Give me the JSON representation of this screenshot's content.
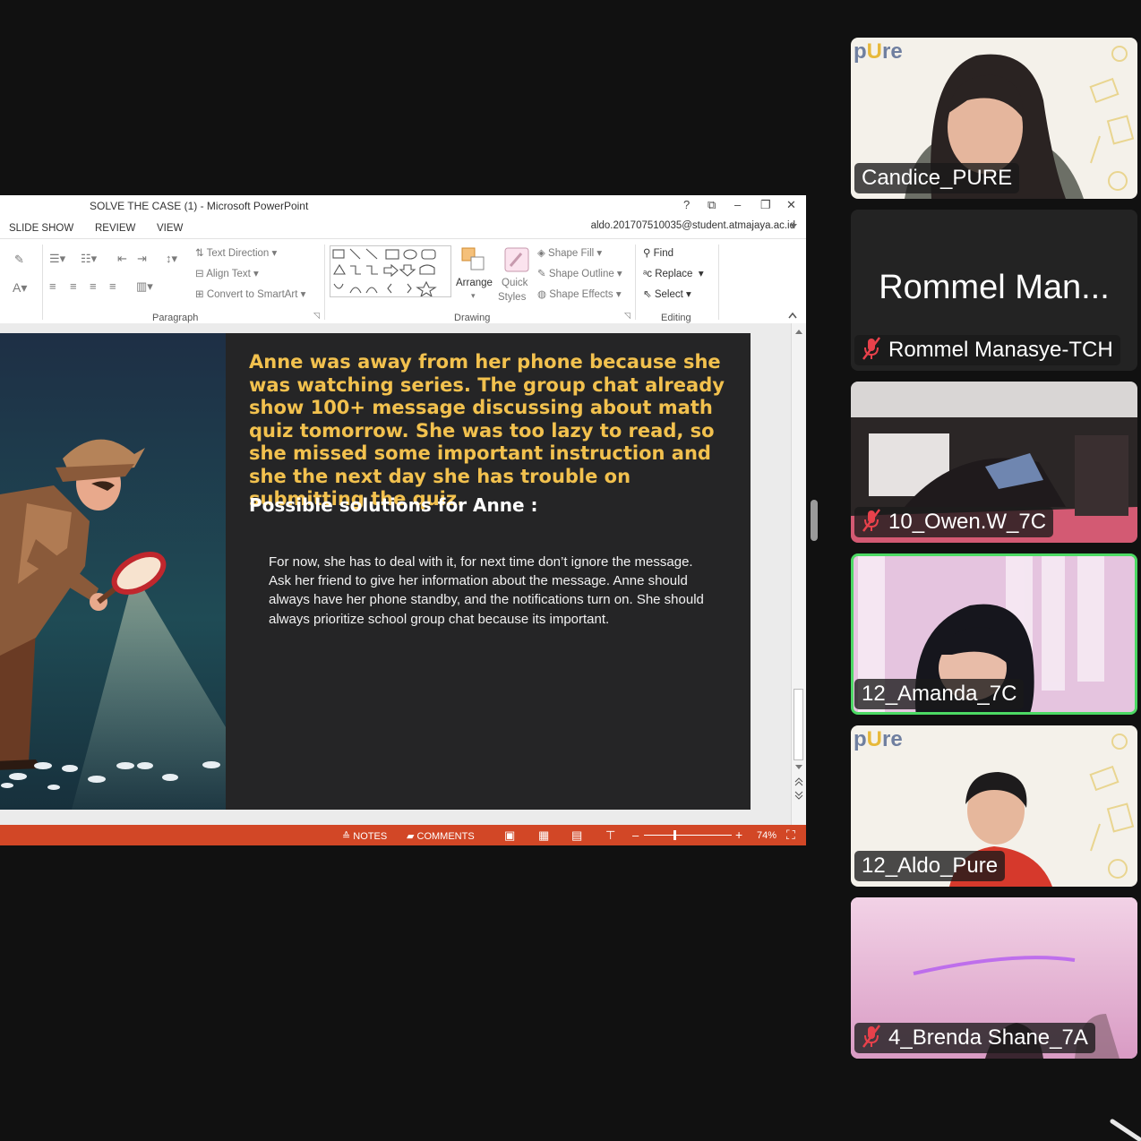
{
  "window": {
    "title": "SOLVE THE CASE (1) - Microsoft PowerPoint",
    "help": "?",
    "restore_ribbon": "⧉",
    "minimize": "–",
    "maximize": "❐",
    "close": "✕",
    "account": "aldo.201707510035@student.atmajaya.ac.id"
  },
  "menu": [
    "SLIDE SHOW",
    "REVIEW",
    "VIEW"
  ],
  "ribbon": {
    "paragraph": {
      "label": "Paragraph",
      "text_direction": "Text Direction",
      "align_text": "Align Text",
      "convert_smartart": "Convert to SmartArt"
    },
    "drawing": {
      "label": "Drawing",
      "arrange": "Arrange",
      "quick_styles": [
        "Quick",
        "Styles"
      ],
      "shape_fill": "Shape Fill",
      "shape_outline": "Shape Outline",
      "shape_effects": "Shape Effects"
    },
    "editing": {
      "label": "Editing",
      "find": "Find",
      "replace": "Replace",
      "select": "Select"
    }
  },
  "slide": {
    "heading": "Anne was away from her phone because she was watching series. The group chat already show 100+ message discussing about math quiz tomorrow. She was too lazy to read, so she missed some important instruction and she the next day she has trouble on submitting the quiz.",
    "subheading": "Possible solutions for Anne :",
    "body": "For now, she has to deal with it, for next time don’t ignore the message. Ask her friend to give her information about the message. Anne should always have her phone standby, and the notifications turn on. She should always prioritize school group chat because its important."
  },
  "status_bar": {
    "notes": "NOTES",
    "comments": "COMMENTS",
    "zoom": "74%"
  },
  "participants": [
    {
      "name": "Candice_PURE",
      "muted": false,
      "active": false,
      "video": true
    },
    {
      "name": "Rommel Manasye-TCH",
      "display_name": "Rommel Man...",
      "muted": true,
      "active": false,
      "video": false
    },
    {
      "name": "10_Owen.W_7C",
      "muted": true,
      "active": false,
      "video": true
    },
    {
      "name": "12_Amanda_7C",
      "muted": false,
      "active": true,
      "video": true
    },
    {
      "name": "12_Aldo_Pure",
      "muted": false,
      "active": false,
      "video": true
    },
    {
      "name": "4_Brenda Shane_7A",
      "muted": true,
      "active": false,
      "video": true
    }
  ],
  "logo": {
    "pre": "p",
    "mid": "U",
    "post": "re"
  },
  "colors": {
    "accent_orange": "#d24726",
    "slide_bg": "#252526",
    "heading_yellow": "#f2c14e",
    "active_speaker": "#4cd964",
    "mute_red": "#e8414b"
  }
}
